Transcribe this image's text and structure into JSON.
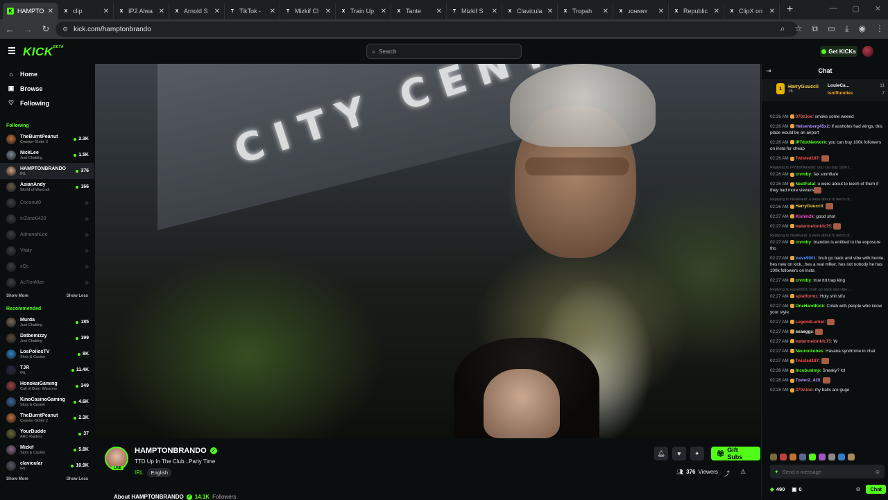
{
  "browser": {
    "tabs": [
      {
        "title": "HAMPTO",
        "favicon": "K",
        "color": "#53fc18",
        "active": true
      },
      {
        "title": "clip",
        "favicon": "X",
        "color": "#ffffff"
      },
      {
        "title": "IP2 Alwa",
        "favicon": "X",
        "color": "#ffffff"
      },
      {
        "title": "Arnold S",
        "favicon": "X",
        "color": "#ffffff"
      },
      {
        "title": "TikTok -",
        "favicon": "T",
        "color": "#ffffff"
      },
      {
        "title": "Mizkif Cl",
        "favicon": "T",
        "color": "#ffffff"
      },
      {
        "title": "Train Up",
        "favicon": "X",
        "color": "#ffffff"
      },
      {
        "title": "Tante",
        "favicon": "X",
        "color": "#ffffff"
      },
      {
        "title": "Mizkif S",
        "favicon": "T",
        "color": "#ffffff"
      },
      {
        "title": "Clavicula",
        "favicon": "X",
        "color": "#ffffff"
      },
      {
        "title": "Tropah",
        "favicon": "X",
        "color": "#ffffff"
      },
      {
        "title": "ᴊᴏʜɴɴʏ",
        "favicon": "X",
        "color": "#ffffff"
      },
      {
        "title": "Republic",
        "favicon": "X",
        "color": "#ffffff"
      },
      {
        "title": "ClipX on",
        "favicon": "X",
        "color": "#ffffff"
      }
    ],
    "url": "kick.com/hamptonbrando"
  },
  "header": {
    "logo": "KICK",
    "logo_beta": "BETA",
    "search_placeholder": "Search",
    "get_kicks": "Get KICKs"
  },
  "sidebar": {
    "nav": [
      {
        "label": "Home",
        "icon": "home-icon"
      },
      {
        "label": "Browse",
        "icon": "browse-icon"
      },
      {
        "label": "Following",
        "icon": "heart-icon"
      }
    ],
    "following_heading": "Following",
    "following": [
      {
        "name": "TheBurntPeanut",
        "category": "Counter-Strike 2",
        "viewers": "2.3K",
        "color": "#c0703a",
        "live": true
      },
      {
        "name": "NickLee",
        "category": "Just Chatting",
        "viewers": "1.5K",
        "color": "#7a8a9a",
        "live": true
      },
      {
        "name": "HAMPTONBRANDO",
        "category": "IRL",
        "viewers": "376",
        "color": "#d1a080",
        "live": true,
        "active": true
      },
      {
        "name": "AsianAndy",
        "category": "World of Warcraft",
        "viewers": "166",
        "color": "#6a5a4a",
        "live": true
      },
      {
        "name": "Coconut0",
        "color": "#888888",
        "live": false
      },
      {
        "name": "InZane0420",
        "color": "#888888",
        "live": false
      },
      {
        "name": "AdrianahLee",
        "color": "#888888",
        "live": false
      },
      {
        "name": "Vitaly",
        "color": "#888888",
        "live": false
      },
      {
        "name": "xQc",
        "color": "#888888",
        "live": false
      },
      {
        "name": "Ac7ionMan",
        "color": "#888888",
        "live": false
      }
    ],
    "show_more": "Show More",
    "show_less": "Show Less",
    "recommended_heading": "Recommended",
    "recommended": [
      {
        "name": "Murda",
        "category": "Just Chatting",
        "viewers": "185",
        "color": "#7a6a5a"
      },
      {
        "name": "Datbemizzy",
        "category": "Just Chatting",
        "viewers": "199",
        "color": "#5a4a3a"
      },
      {
        "name": "LosPollosTV",
        "category": "Slots & Casino",
        "viewers": "8K",
        "color": "#2a8ad0"
      },
      {
        "name": "TJR",
        "category": "IRL",
        "viewers": "11.4K",
        "color": "#222a44"
      },
      {
        "name": "HonokaiGaming",
        "category": "Call of Duty: Warzone",
        "viewers": "349",
        "color": "#a04040"
      },
      {
        "name": "KinoCasinoGaming",
        "category": "Slots & Casino",
        "viewers": "4.6K",
        "color": "#3a6a9a"
      },
      {
        "name": "TheBurntPeanut",
        "category": "Counter-Strike 2",
        "viewers": "2.3K",
        "color": "#c0703a"
      },
      {
        "name": "YourBudde",
        "category": "ARC Raiders",
        "viewers": "37",
        "color": "#6a6a3a"
      },
      {
        "name": "Mizkif",
        "category": "Slots & Casino",
        "viewers": "5.8K",
        "color": "#8a6a8a"
      },
      {
        "name": "clavicular",
        "category": "IRL",
        "viewers": "10.9K",
        "color": "#5a5a6a"
      }
    ]
  },
  "stream": {
    "streamer": "HAMPTONBRANDO",
    "live_badge": "LIVE",
    "title": "TTD Up In The Club...Party Time",
    "category": "IRL",
    "language": "English",
    "gift_subs": "Gift Subs",
    "viewers": "376",
    "viewers_label": "Viewers",
    "about_prefix": "About HAMPTONBRANDO",
    "followers": "14.1K",
    "followers_label": "Followers"
  },
  "chat": {
    "title": "Chat",
    "pinned": {
      "rank": "1",
      "user": "HarryGuuccii",
      "count": "16",
      "leaders": [
        {
          "name": "LouieCa...",
          "count": "11"
        },
        {
          "name": "Isniffundies",
          "count": "7"
        }
      ]
    },
    "messages": [
      {
        "time": "02:26 AM",
        "user": "370zJoe",
        "color": "#e65a5a",
        "text": "smoke some weeed"
      },
      {
        "time": "02:26 AM",
        "user": "Heisenberg45x2",
        "color": "#b48cff",
        "text": "If assholes had wings, this place would be an airport"
      },
      {
        "time": "02:26 AM",
        "user": "IP7dotNetwork",
        "color": "#53fc18",
        "text": "you can buy 100k followers on insta for cheap"
      },
      {
        "time": "02:26 AM",
        "user": "Twisted187",
        "color": "#ff4d4d",
        "text": "",
        "emote": true
      },
      {
        "time": "02:26 AM",
        "user": "crvmby",
        "color": "#53fc18",
        "text": "fax smmflare",
        "reply": "Replying to IP7dotNetwork: you can buy 100k f..."
      },
      {
        "time": "02:26 AM",
        "user": "NeatFatal",
        "color": "#53fc18",
        "text": "u were about to leech of them if they had more viewers",
        "emote": true
      },
      {
        "time": "02:26 AM",
        "user": "HarryGuuccii",
        "color": "#f5d142",
        "text": "",
        "emote": true,
        "reply": "Replying to NeatFatal: u were about to leech of..."
      },
      {
        "time": "02:27 AM",
        "user": "Kishin2k",
        "color": "#ff4dd2",
        "text": "good shot"
      },
      {
        "time": "02:27 AM",
        "user": "watermelonkfc75",
        "color": "#e65a5a",
        "text": "",
        "emote": true
      },
      {
        "time": "02:27 AM",
        "user": "crvmby",
        "color": "#53fc18",
        "text": "brandon is entitled to the exposure tho",
        "reply": "Replying to NeatFatal: u were about to leech of..."
      },
      {
        "time": "02:27 AM",
        "user": "wave9901",
        "color": "#4d8bff",
        "text": "bruh go back and vibe with homie, hes new on kick...hes a real mfker, hes not nobody he has 100k followers on insta"
      },
      {
        "time": "02:27 AM",
        "user": "crvmby",
        "color": "#53fc18",
        "text": "true ttd trap king"
      },
      {
        "time": "02:27 AM",
        "user": "splatformz",
        "color": "#e65a5a",
        "text": "Holy shit stfu",
        "reply": "Replying to wave9901: bruh go back and vibe ..."
      },
      {
        "time": "02:27 AM",
        "user": "OneHandKick",
        "color": "#53fc18",
        "text": "Colab with people who know your style"
      },
      {
        "time": "02:27 AM",
        "user": "LegendLurker",
        "color": "#ff4d4d",
        "text": "",
        "emote": true
      },
      {
        "time": "02:27 AM",
        "user": "seaeggs",
        "color": "#e6e6e6",
        "text": "",
        "emote": true
      },
      {
        "time": "02:27 AM",
        "user": "watermelonkfc75",
        "color": "#e65a5a",
        "text": "W"
      },
      {
        "time": "02:27 AM",
        "user": "Neurockones",
        "color": "#53fc18",
        "text": "Havana syndrome in chat"
      },
      {
        "time": "02:27 AM",
        "user": "Twisted187",
        "color": "#ff4d4d",
        "text": "",
        "emote": true
      },
      {
        "time": "02:28 AM",
        "user": "IncubusImp",
        "color": "#53fc18",
        "text": "Sneaky? lol"
      },
      {
        "time": "02:28 AM",
        "user": "Tower2_420",
        "color": "#b48cff",
        "text": "",
        "emote": true
      },
      {
        "time": "02:28 AM",
        "user": "370zJoe",
        "color": "#e65a5a",
        "text": "my balls are guge"
      }
    ],
    "input_placeholder": "Send a message",
    "kicks": "490",
    "points": "0",
    "send": "Chat"
  }
}
